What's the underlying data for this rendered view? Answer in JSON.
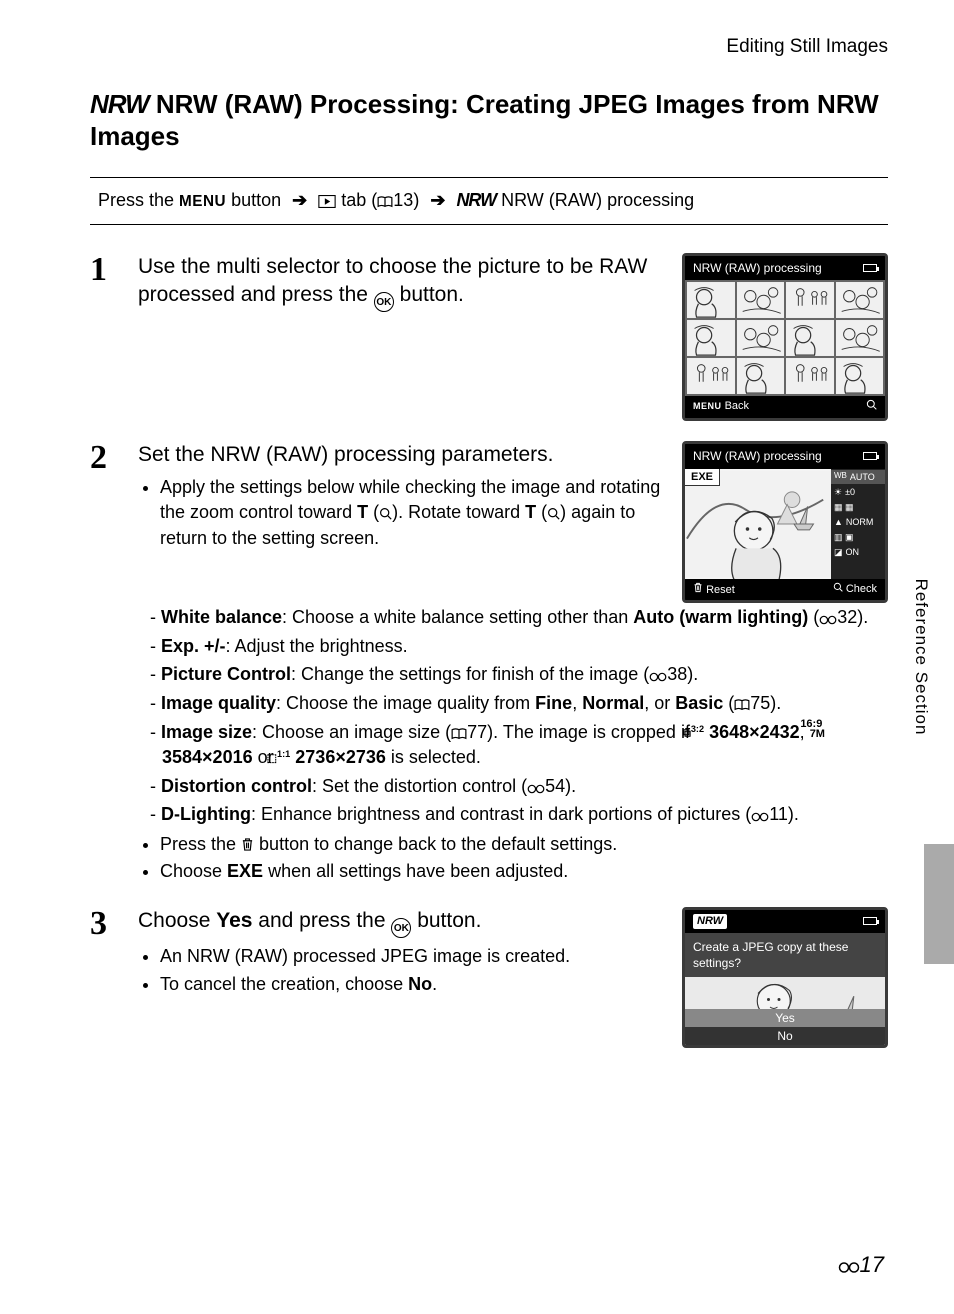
{
  "header": {
    "section_name": "Editing Still Images"
  },
  "title": {
    "nrw_prefix": "NRW",
    "text": "NRW (RAW) Processing: Creating JPEG Images from NRW Images"
  },
  "nav": {
    "prefix": "Press the ",
    "menu_btn": "MENU",
    "mid1": " button ",
    "tab_ref": " tab (",
    "tab_page": "13) ",
    "nrw_mark": "NRW",
    "tail": " NRW (RAW) processing"
  },
  "steps": {
    "s1": {
      "num": "1",
      "text_a": "Use the multi selector to choose the picture to be RAW processed and press the ",
      "text_b": " button."
    },
    "s2": {
      "num": "2",
      "head": "Set the NRW (RAW) processing parameters.",
      "b1a": "Apply the settings below while checking the image and rotating the zoom control toward ",
      "b1_t": "T",
      "b1b": "). Rotate toward ",
      "b1c": ") again to return to the setting screen.",
      "d_wb_l": "White balance",
      "d_wb_t": ": Choose a white balance setting other than ",
      "d_wb_b": "Auto (warm lighting)",
      "d_wb_ref": "32).",
      "d_exp_l": "Exp. +/-",
      "d_exp_t": ": Adjust the brightness.",
      "d_pc_l": "Picture Control",
      "d_pc_t": ": Change the settings for finish of the image (",
      "d_pc_ref": "38).",
      "d_iq_l": "Image quality",
      "d_iq_t": ": Choose the image quality from ",
      "d_iq_f": "Fine",
      "d_iq_n": "Normal",
      "d_iq_b": "Basic",
      "d_iq_ref": "75).",
      "d_is_l": "Image size",
      "d_is_t1": ": Choose an image size (",
      "d_is_ref1": "77). The image is cropped if ",
      "d_is_r32": "3648×2432",
      "d_is_r169": "3584×2016",
      "d_is_r11": "2736×2736",
      "d_is_tail": " is selected.",
      "d_dc_l": "Distortion control",
      "d_dc_t": ": Set the distortion control (",
      "d_dc_ref": "54).",
      "d_dl_l": "D-Lighting",
      "d_dl_t": ": Enhance brightness and contrast in dark portions of pictures (",
      "d_dl_ref": "11).",
      "b2a": "Press the ",
      "b2b": " button to change back to the default settings.",
      "b3a": "Choose ",
      "b3b": "EXE",
      "b3c": " when all settings have been adjusted."
    },
    "s3": {
      "num": "3",
      "head_a": "Choose ",
      "head_y": "Yes",
      "head_b": " and press the ",
      "head_c": " button.",
      "b1": "An NRW (RAW) processed JPEG image is created.",
      "b2a": "To cancel the creation, choose ",
      "b2_no": "No",
      "b2b": "."
    }
  },
  "screens": {
    "s1": {
      "title": "NRW (RAW) processing",
      "back": "Back"
    },
    "s2": {
      "title": "NRW (RAW) processing",
      "exe": "EXE",
      "wb": "AUTO",
      "exp": "±0",
      "norm": "NORM",
      "on": "ON",
      "reset": "Reset",
      "check": "Check"
    },
    "s3": {
      "msg": "Create a JPEG copy at these settings?",
      "yes": "Yes",
      "no": "No"
    }
  },
  "side": {
    "label": "Reference Section",
    "page": "17"
  }
}
